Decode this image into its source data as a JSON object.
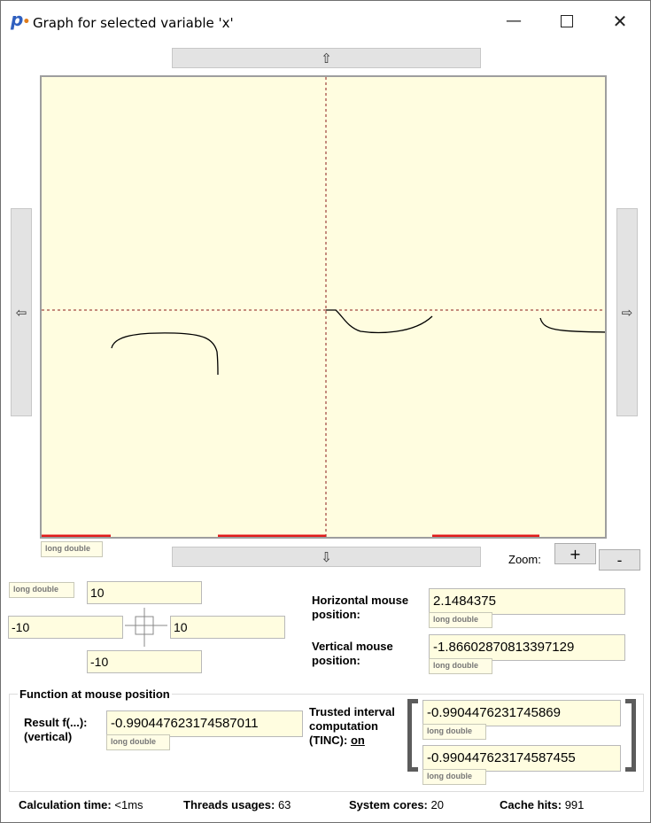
{
  "window": {
    "title": "Graph for selected variable 'x'",
    "logo_letter": "p",
    "controls": {
      "minimize": "—",
      "maximize": "",
      "close": "✕"
    }
  },
  "pan": {
    "up": "⇧",
    "down": "⇩",
    "left": "⇦",
    "right": "⇨"
  },
  "plot": {
    "type_tag": "long double",
    "background": "#fffde0",
    "axis_color": "#8b1a1a",
    "curve_color": "#000000",
    "out_of_range_color": "#e01b1b"
  },
  "zoom": {
    "label": "Zoom:",
    "in": "+",
    "out": "-"
  },
  "range": {
    "type_tag": "long double",
    "top": "10",
    "left": "-10",
    "right": "10",
    "bottom": "-10"
  },
  "mouse": {
    "horizontal_label": "Horizontal mouse position:",
    "horizontal_value": "2.1484375",
    "horizontal_type": "long double",
    "vertical_label": "Vertical mouse position:",
    "vertical_value": "-1.86602870813397129",
    "vertical_type": "long double"
  },
  "function_group": {
    "title": "Function at mouse position",
    "result_label": "Result f(...): (vertical)",
    "result_value": "-0.990447623174587011",
    "result_type": "long double",
    "trusted_label": "Trusted interval computation (TINC):",
    "trusted_state": "on",
    "interval_low": "-0.9904476231745869",
    "interval_low_type": "long double",
    "interval_high": "-0.990447623174587455",
    "interval_high_type": "long double"
  },
  "status": {
    "calc_label": "Calculation time:",
    "calc_value": "<1ms",
    "threads_label": "Threads usages:",
    "threads_value": "63",
    "cores_label": "System cores:",
    "cores_value": "20",
    "cache_label": "Cache hits:",
    "cache_value": "991"
  }
}
